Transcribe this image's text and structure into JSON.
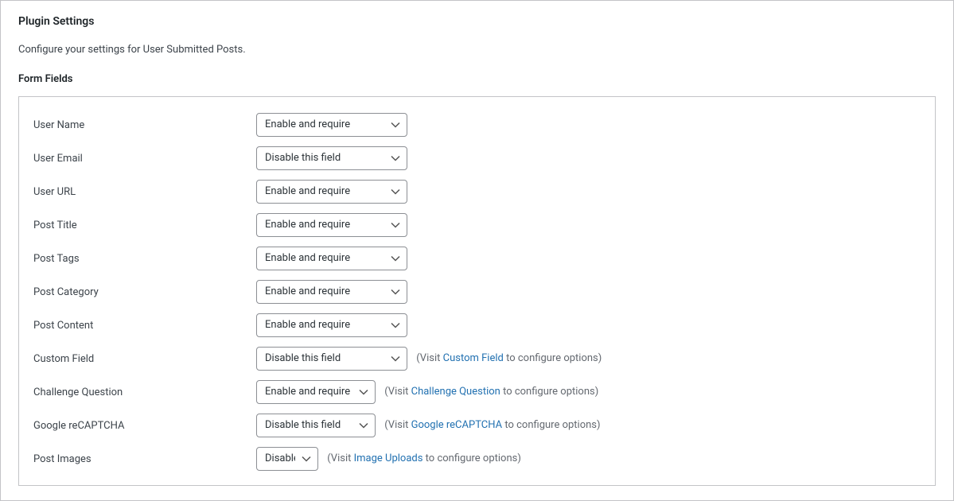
{
  "page": {
    "title": "Plugin Settings",
    "description": "Configure your settings for User Submitted Posts.",
    "section_title": "Form Fields"
  },
  "fields": {
    "user_name": {
      "label": "User Name",
      "value": "Enable and require"
    },
    "user_email": {
      "label": "User Email",
      "value": "Disable this field"
    },
    "user_url": {
      "label": "User URL",
      "value": "Enable and require"
    },
    "post_title": {
      "label": "Post Title",
      "value": "Enable and require"
    },
    "post_tags": {
      "label": "Post Tags",
      "value": "Enable and require"
    },
    "post_category": {
      "label": "Post Category",
      "value": "Enable and require"
    },
    "post_content": {
      "label": "Post Content",
      "value": "Enable and require"
    },
    "custom_field": {
      "label": "Custom Field",
      "value": "Disable this field",
      "note_pre": "(Visit ",
      "note_link": "Custom Field",
      "note_post": " to configure options)"
    },
    "challenge": {
      "label": "Challenge Question",
      "value": "Enable and require",
      "note_pre": "(Visit ",
      "note_link": "Challenge Question",
      "note_post": " to configure options)"
    },
    "recaptcha": {
      "label": "Google reCAPTCHA",
      "value": "Disable this field",
      "note_pre": "(Visit ",
      "note_link": "Google reCAPTCHA",
      "note_post": " to configure options)"
    },
    "post_images": {
      "label": "Post Images",
      "value": "Disable",
      "note_pre": "(Visit ",
      "note_link": "Image Uploads",
      "note_post": " to configure options)"
    }
  }
}
